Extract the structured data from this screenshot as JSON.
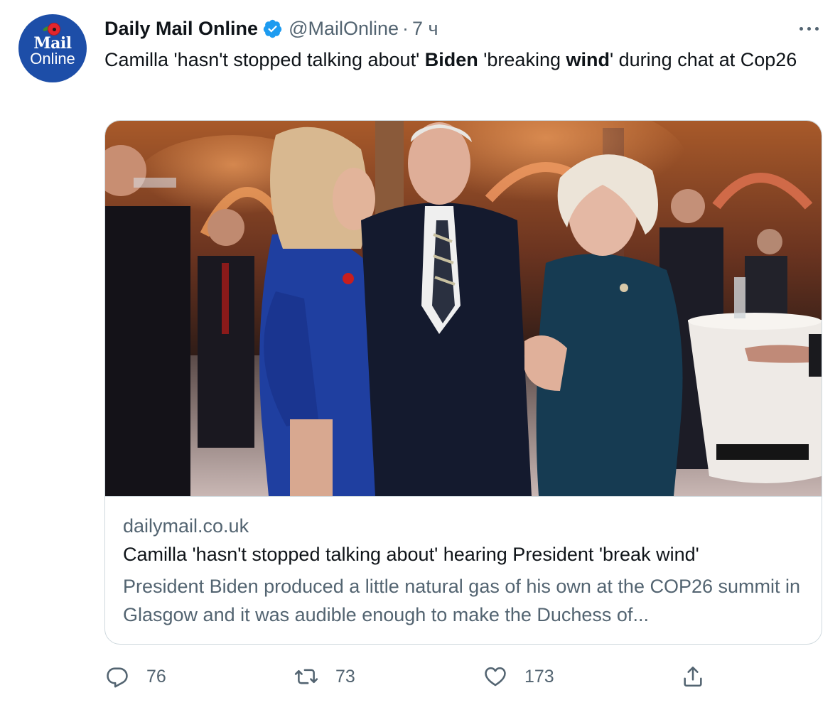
{
  "tweet": {
    "author_name": "Daily Mail Online",
    "handle": "@MailOnline",
    "separator": "·",
    "time": "7 ч",
    "text_parts": [
      "Camilla 'hasn't stopped talking about' ",
      "Biden",
      " 'breaking ",
      "wind",
      "' during chat at Cop26"
    ]
  },
  "avatar": {
    "logo_line1": "Mail",
    "logo_line2": "Online",
    "background_color": "#1d4ea8"
  },
  "card": {
    "domain": "dailymail.co.uk",
    "title": "Camilla 'hasn't stopped talking about' hearing President 'break wind'",
    "description": "President Biden produced a little natural gas of his own at the COP26 summit in Glasgow and it was audible enough to make the Duchess of..."
  },
  "actions": {
    "reply_count": "76",
    "retweet_count": "73",
    "like_count": "173"
  },
  "icons": {
    "verified": "verified-badge-icon",
    "more": "more-options-icon",
    "reply": "reply-icon",
    "retweet": "retweet-icon",
    "like": "heart-icon",
    "share": "share-icon"
  },
  "colors": {
    "accent": "#1d9bf0",
    "text_primary": "#0f1419",
    "text_secondary": "#536471",
    "border": "#cfd9de"
  }
}
